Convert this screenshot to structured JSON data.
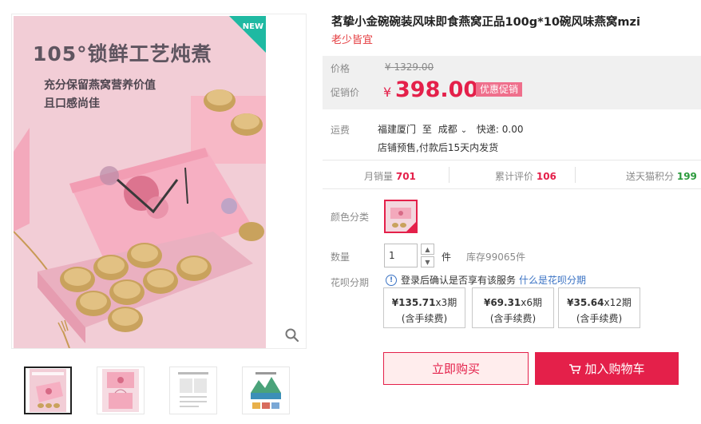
{
  "gallery": {
    "badge": "NEW",
    "image_headline": "105°锁鲜工艺炖煮",
    "image_line1": "充分保留燕窝营养价值",
    "image_line2": "且口感尚佳",
    "zoom_icon": "magnifier-icon"
  },
  "product": {
    "title": "茗挚小金碗碗装风味即食燕窝正品100g*10碗风味燕窝mzi",
    "subtitle": "老少皆宜"
  },
  "price": {
    "original_label": "价格",
    "original_value": "1329.00",
    "original_symbol": "¥",
    "promo_label": "促销价",
    "promo_symbol": "¥",
    "promo_value": "398.00",
    "promo_badge": "优惠促销"
  },
  "shipping": {
    "label": "运费",
    "from": "福建厦门",
    "to_word": "至",
    "to": "成都",
    "express": "快递: 0.00",
    "note": "店铺预售,付款后15天内发货"
  },
  "stats": {
    "monthly_sales_label": "月销量",
    "monthly_sales": "701",
    "reviews_label": "累计评价",
    "reviews": "106",
    "points_label": "送天猫积分",
    "points": "199"
  },
  "options": {
    "color_label": "颜色分类",
    "quantity_label": "数量",
    "quantity_value": "1",
    "quantity_unit": "件",
    "stock": "库存99065件"
  },
  "huabei": {
    "label": "花呗分期",
    "info": "登录后确认是否享有该服务",
    "link": "什么是花呗分期",
    "plans": [
      {
        "amount": "¥135.71",
        "periods": "x3期",
        "fee": "(含手续费)"
      },
      {
        "amount": "¥69.31",
        "periods": "x6期",
        "fee": "(含手续费)"
      },
      {
        "amount": "¥35.64",
        "periods": "x12期",
        "fee": "(含手续费)"
      }
    ]
  },
  "actions": {
    "buy_now": "立即购买",
    "add_to_cart": "加入购物车"
  },
  "colors": {
    "accent": "#e4204a",
    "badge_green": "#1fb9a2",
    "link_blue": "#3b73c4"
  }
}
